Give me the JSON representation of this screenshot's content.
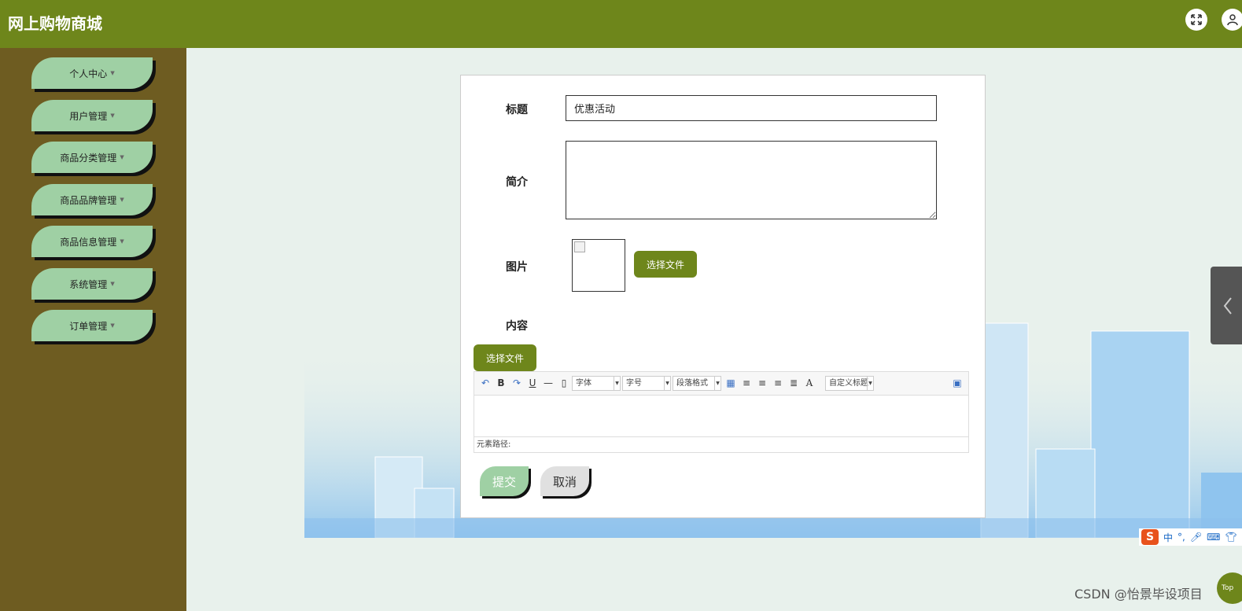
{
  "header": {
    "title": "网上购物商城",
    "fullscreen_icon": "fullscreen-icon",
    "user_icon": "user-icon"
  },
  "sidebar": {
    "items": [
      {
        "label": "个人中心"
      },
      {
        "label": "用户管理"
      },
      {
        "label": "商品分类管理"
      },
      {
        "label": "商品品牌管理"
      },
      {
        "label": "商品信息管理"
      },
      {
        "label": "系统管理"
      },
      {
        "label": "订单管理"
      }
    ]
  },
  "form": {
    "title_label": "标题",
    "title_value": "优惠活动",
    "intro_label": "简介",
    "intro_value": "",
    "image_label": "图片",
    "image_button": "选择文件",
    "content_label": "内容",
    "content_button": "选择文件",
    "editor": {
      "font_select": "字体",
      "size_select": "字号",
      "paragraph_select": "段落格式",
      "custom_title_select": "自定义标题",
      "path_label": "元素路径:"
    },
    "submit": "提交",
    "cancel": "取消"
  },
  "ime": {
    "logo": "S",
    "lang": "中"
  },
  "watermark": "CSDN @怡景毕设项目",
  "back_to_top": "Top",
  "colors": {
    "header": "#6e861b",
    "sidebar": "#6e5c21",
    "menu_item": "#9fd0a4",
    "olive_button": "#6e861b"
  }
}
